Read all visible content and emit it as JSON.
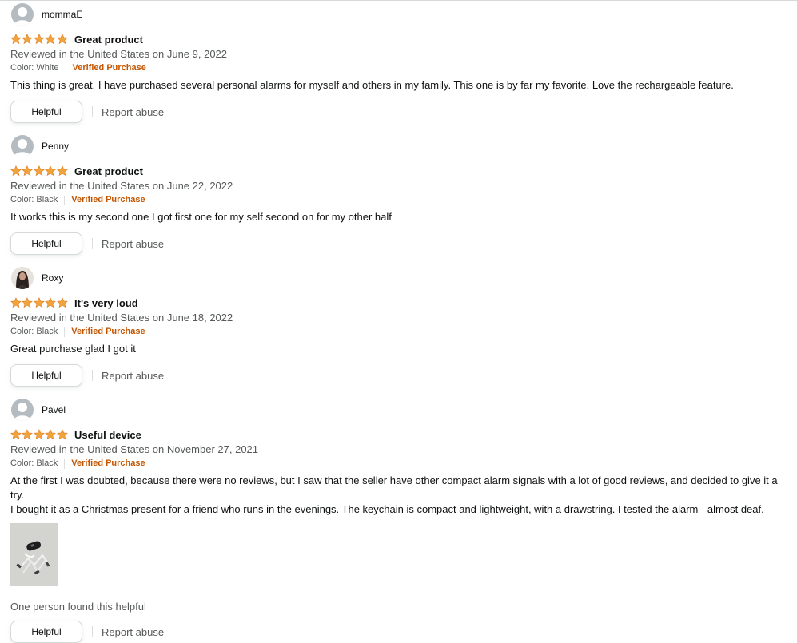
{
  "common": {
    "helpful_label": "Helpful",
    "report_label": "Report abuse",
    "verified_label": "Verified Purchase",
    "star_color": "#de7921",
    "verified_color": "#c45500"
  },
  "reviews": [
    {
      "username": "mommaE",
      "avatar": "default-avatar-icon",
      "rating": 5,
      "title": "Great product",
      "date": "Reviewed in the United States on June 9, 2022",
      "color": "Color: White",
      "body": "This thing is great. I have purchased several personal alarms for myself and others in my family. This one is by far my favorite. Love the rechargeable feature."
    },
    {
      "username": "Penny",
      "avatar": "default-avatar-icon",
      "rating": 5,
      "title": "Great product",
      "date": "Reviewed in the United States on June 22, 2022",
      "color": "Color: Black",
      "body": "It works this is my second one I got first one for my self second on for my other half"
    },
    {
      "username": "Roxy",
      "avatar": "photo-avatar",
      "rating": 5,
      "title": "It's very loud",
      "date": "Reviewed in the United States on June 18, 2022",
      "color": "Color: Black",
      "body": "Great purchase glad I got it"
    },
    {
      "username": "Pavel",
      "avatar": "default-avatar-icon",
      "rating": 5,
      "title": "Useful device",
      "date": "Reviewed in the United States on November 27, 2021",
      "color": "Color: Black",
      "body_lines": [
        "At the first I was doubted, because there were no reviews, but I saw that the seller have other compact alarm signals with a lot of good reviews, and decided to give it a try.",
        "I bought it as a Christmas present for a friend who runs in the evenings. The keychain is compact and lightweight, with a drawstring. I tested the alarm - almost deaf."
      ],
      "helpful_count": "One person found this helpful"
    }
  ]
}
